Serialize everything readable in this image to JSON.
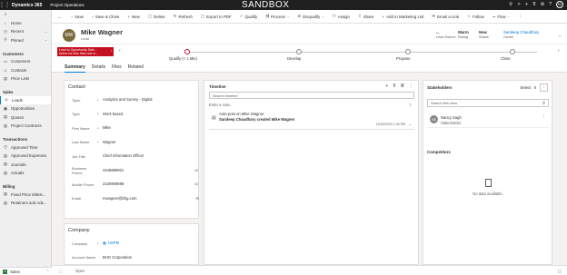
{
  "topbar": {
    "app_name": "Dynamics 365",
    "area": "Project Operations",
    "banner": "SANDBOX",
    "user_initials": "SC"
  },
  "sidebar": {
    "top_items": [
      {
        "label": "Home",
        "icon": "home-icon",
        "glyph": "⌂"
      },
      {
        "label": "Recent",
        "icon": "clock-icon",
        "glyph": "◷",
        "chevron": "⌄"
      },
      {
        "label": "Pinned",
        "icon": "pin-icon",
        "glyph": "⚲",
        "chevron": "⌄"
      }
    ],
    "groups": [
      {
        "title": "Customers",
        "items": [
          {
            "label": "Customers",
            "glyph": "▭"
          },
          {
            "label": "Contacts",
            "glyph": "☺"
          },
          {
            "label": "Price Lists",
            "glyph": "▤"
          }
        ]
      },
      {
        "title": "Sales",
        "items": [
          {
            "label": "Leads",
            "glyph": "☏",
            "active": true
          },
          {
            "label": "Opportunities",
            "glyph": "▣"
          },
          {
            "label": "Quotes",
            "glyph": "▤"
          },
          {
            "label": "Project Contracts",
            "glyph": "▤"
          }
        ]
      },
      {
        "title": "Transactions",
        "items": [
          {
            "label": "Approved Time",
            "glyph": "◷"
          },
          {
            "label": "Approved Expenses",
            "glyph": "▤"
          },
          {
            "label": "Journals",
            "glyph": "▤"
          },
          {
            "label": "Actuals",
            "glyph": "▤"
          }
        ]
      },
      {
        "title": "Billing",
        "items": [
          {
            "label": "Fixed Price Milest...",
            "glyph": "▤"
          },
          {
            "label": "Retainers and Adv...",
            "glyph": "▤"
          }
        ]
      }
    ],
    "area_switcher": {
      "label": "Sales",
      "badge": "S",
      "chevron": "⌃"
    }
  },
  "commands": [
    {
      "label": "Save",
      "glyph": "▫"
    },
    {
      "label": "Save & Close",
      "glyph": "▫"
    },
    {
      "label": "New",
      "glyph": "+"
    },
    {
      "label": "Delete",
      "glyph": "▢"
    },
    {
      "label": "Refresh",
      "glyph": "↻"
    },
    {
      "label": "Export to PDF",
      "glyph": "▢"
    },
    {
      "label": "Qualify",
      "glyph": "✓"
    },
    {
      "label": "Process",
      "glyph": "⇶",
      "dropdown": true
    },
    {
      "label": "Disqualify",
      "glyph": "⊘",
      "dropdown": true
    },
    {
      "label": "Assign",
      "glyph": "⚇"
    },
    {
      "label": "Share",
      "glyph": "⇪"
    },
    {
      "label": "Add to Marketing List",
      "glyph": "+"
    },
    {
      "label": "Email a Link",
      "glyph": "✉"
    },
    {
      "label": "Follow",
      "glyph": "☆"
    },
    {
      "label": "Flow",
      "glyph": "⤳",
      "dropdown": true
    },
    {
      "label": "⋮",
      "glyph": ""
    }
  ],
  "record": {
    "initials": "MW",
    "name": "Mike Wagner",
    "entity": "Lead",
    "header_fields": [
      {
        "value": "...",
        "label": "Lead Source"
      },
      {
        "value": "Warm",
        "label": "Rating"
      },
      {
        "value": "New",
        "label": "Status"
      },
      {
        "value": "Sandeep Chaudhary",
        "label": "Owner",
        "link": true
      }
    ]
  },
  "bpf": {
    "alert_title": "Lead to Opportunity Sale...",
    "alert_sub": "Active for less than one m...",
    "stages": [
      {
        "label": "Qualify  (< 1 Min)",
        "active": true
      },
      {
        "label": "Develop"
      },
      {
        "label": "Propose"
      },
      {
        "label": "Close"
      }
    ]
  },
  "tabs": [
    "Summary",
    "Details",
    "Files",
    "Related"
  ],
  "contact": {
    "title": "Contact",
    "fields": [
      {
        "label": "Topic",
        "req": "*",
        "value": "Analytics and Survey - Digital"
      },
      {
        "label": "Type",
        "req": "*",
        "value": "Work based"
      },
      {
        "label": "First Name",
        "req": "*",
        "value": "Mike"
      },
      {
        "label": "Last Name",
        "req": "*",
        "value": "Wagner"
      },
      {
        "label": "Job Title",
        "req": "",
        "value": "Chief Information Officer"
      },
      {
        "label": "Business Phone",
        "req": "",
        "value": "4449898001",
        "tail": "☏"
      },
      {
        "label": "Mobile Phone",
        "req": "",
        "value": "2228909898",
        "tail": "☏"
      },
      {
        "label": "Email",
        "req": "",
        "value": "mwagner@bhg.com",
        "tail": "✉"
      }
    ]
  },
  "company": {
    "title": "Company",
    "fields": [
      {
        "label": "Company",
        "req": "*",
        "value": "USPM",
        "link": true,
        "badge": "▦"
      },
      {
        "label": "Account Name",
        "req": "",
        "value": "BHG Corporation"
      }
    ]
  },
  "timeline": {
    "title": "Timeline",
    "tools": [
      "+",
      "⊽",
      "≣",
      "⋮"
    ],
    "search_placeholder": "Search timeline",
    "note_placeholder": "Enter a note...",
    "posts": [
      {
        "title": "Auto-post on Mike Wagner",
        "body": "Sandeep Chaudhary created Mike Wagner",
        "date": "12/30/2020 1:25 PM"
      }
    ]
  },
  "stakeholders": {
    "title": "Stakeholders",
    "select_label": "Select",
    "search_placeholder": "Search this view",
    "items": [
      {
        "initials": "NS",
        "name": "Nancy Sagh",
        "role": "Stakeholder"
      }
    ],
    "competitors_title": "Competitors",
    "no_data": "No data available."
  },
  "footer": {
    "status": "Open",
    "save_glyph": "▢"
  },
  "colors": {
    "accent": "#0078d4",
    "alert": "#c50f1f",
    "topbar": "#1f1f1f"
  }
}
